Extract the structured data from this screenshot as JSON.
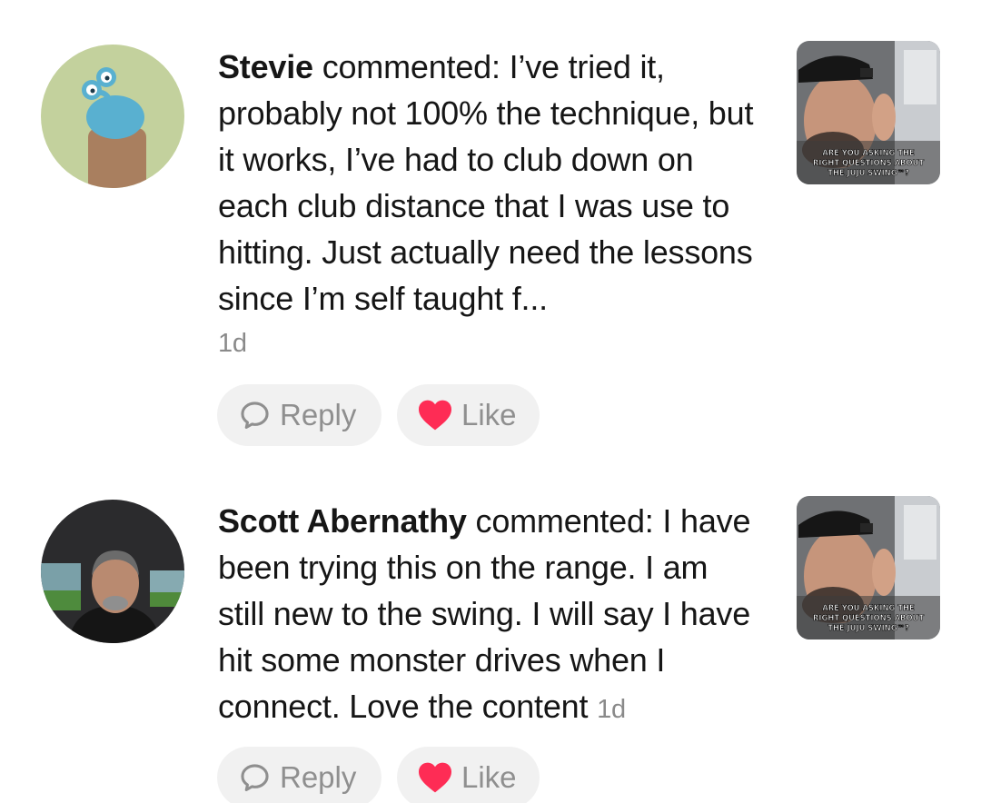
{
  "comments": [
    {
      "author": "Stevie",
      "action_text": "commented:",
      "text": "I’ve tried it, probably not 100% the technique, but it works, I’ve had to club down on each club distance that I was use to hitting. Just actually need the lessons since I’m self taught f...",
      "time": "1d",
      "avatar_icon": "cartoon-creature-avatar",
      "thumbnail_caption": "ARE YOU ASKING THE RIGHT QUESTIONS ABOUT THE JUJU SWING™?",
      "reply_label": "Reply",
      "like_label": "Like"
    },
    {
      "author": "Scott Abernathy",
      "action_text": "commented:",
      "text": "I have been trying this on the range. I am still new to the swing. I will say I have hit some monster drives when I connect. Love the content",
      "time": "1d",
      "avatar_icon": "man-in-car-avatar",
      "thumbnail_caption": "ARE YOU ASKING THE RIGHT QUESTIONS ABOUT THE JUJU SWING™?",
      "reply_label": "Reply",
      "like_label": "Like"
    }
  ],
  "colors": {
    "heart": "#fe2c55",
    "button_bg": "#f1f1f1",
    "muted_text": "#8a8a8a"
  }
}
